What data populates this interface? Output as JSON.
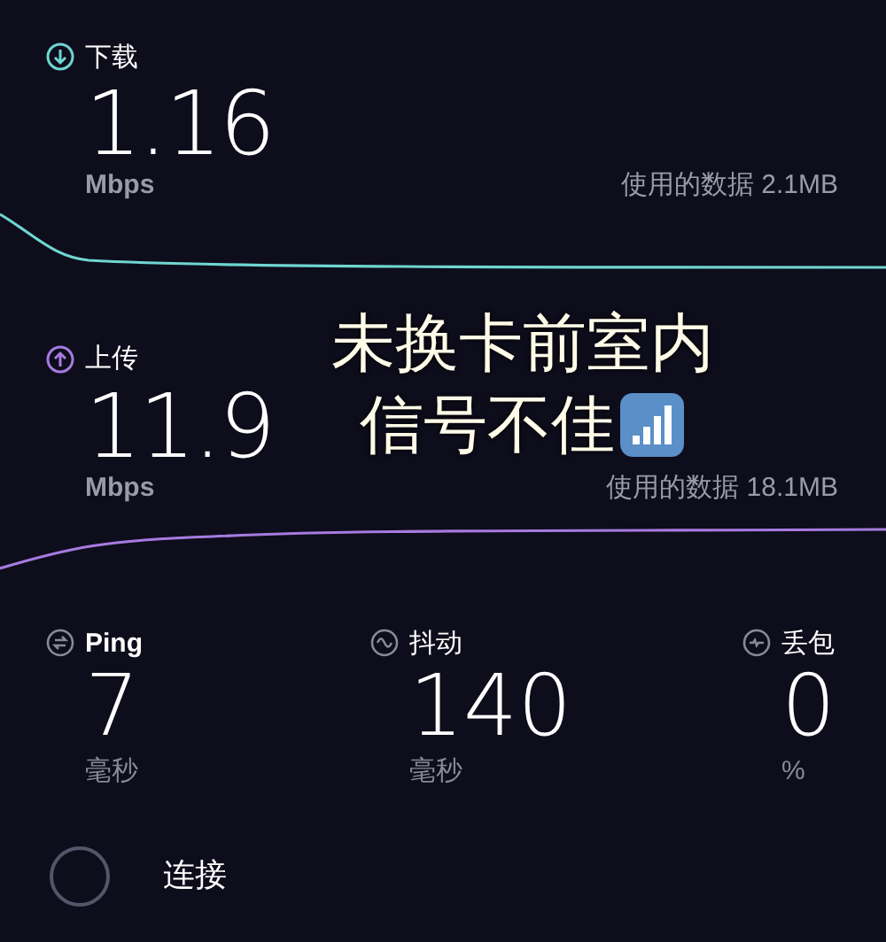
{
  "tests": [
    {
      "kind": "download",
      "label": "下载",
      "value": "1.16",
      "unit": "Mbps",
      "data_used": "使用的数据 2.1MB"
    },
    {
      "kind": "upload",
      "label": "上传",
      "value": "11.9",
      "unit": "Mbps",
      "data_used": "使用的数据 18.1MB"
    }
  ],
  "caption": {
    "lines": [
      "未换卡前室内",
      "信号不佳"
    ]
  },
  "stats": [
    {
      "kind": "ping",
      "label": "Ping",
      "value": "7",
      "unit": "毫秒"
    },
    {
      "kind": "jitter",
      "label": "抖动",
      "value": "140",
      "unit": "毫秒"
    },
    {
      "kind": "loss",
      "label": "丢包",
      "value": "0",
      "unit": "%"
    }
  ],
  "connection": {
    "label": "连接"
  }
}
